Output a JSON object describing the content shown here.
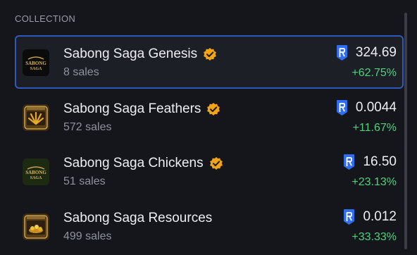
{
  "header": {
    "title": "COLLECTION"
  },
  "colors": {
    "positive": "#4cd37a",
    "selected_border": "#2f59b8",
    "ron_blue": "#2f6df1",
    "verified": "#f2a316"
  },
  "collections": [
    {
      "name": "Sabong Saga Genesis",
      "sales": "8 sales",
      "price": "324.69",
      "change": "+62.75%",
      "verified": true,
      "icon": "sabong-saga-logo-icon",
      "selected": true
    },
    {
      "name": "Sabong Saga Feathers",
      "sales": "572 sales",
      "price": "0.0044",
      "change": "+11.67%",
      "verified": true,
      "icon": "feathers-icon",
      "selected": false
    },
    {
      "name": "Sabong Saga Chickens",
      "sales": "51 sales",
      "price": "16.50",
      "change": "+23.13%",
      "verified": true,
      "icon": "sabong-saga-chickens-icon",
      "selected": false
    },
    {
      "name": "Sabong Saga Resources",
      "sales": "499 sales",
      "price": "0.012",
      "change": "+33.33%",
      "verified": false,
      "icon": "resources-icon",
      "selected": false
    }
  ]
}
